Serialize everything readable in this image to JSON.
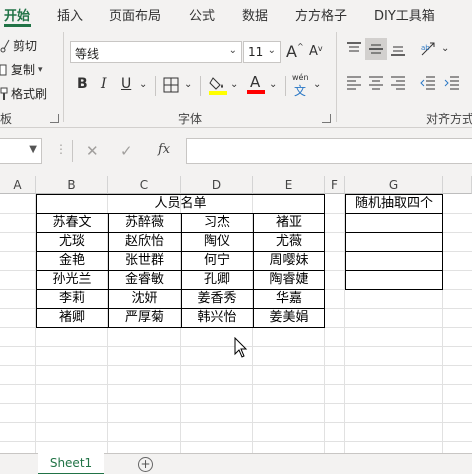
{
  "ribbon_tabs": [
    "开始",
    "插入",
    "页面布局",
    "公式",
    "数据",
    "方方格子",
    "DIY工具箱"
  ],
  "clipboard": {
    "cut": "剪切",
    "copy": "复制",
    "format_painter": "格式刷",
    "group_label": "板"
  },
  "font": {
    "name": "等线",
    "size": "11",
    "grow": "A",
    "shrink": "A",
    "bold": "B",
    "italic": "I",
    "underline": "U",
    "font_color_letter": "A",
    "phonetic_top": "wén",
    "phonetic_bottom": "文",
    "group_label": "字体"
  },
  "alignment": {
    "group_label": "对齐方式"
  },
  "formula_bar": {
    "fx": "fx",
    "cancel": "✕",
    "confirm": "✓",
    "value": ""
  },
  "columns": [
    "A",
    "B",
    "C",
    "D",
    "E",
    "F",
    "G"
  ],
  "table": {
    "title": "人员名单",
    "rows": [
      [
        "苏春文",
        "苏醉薇",
        "习杰",
        "褚亚"
      ],
      [
        "尤琰",
        "赵欣怡",
        "陶仪",
        "尤薇"
      ],
      [
        "金艳",
        "张世群",
        "何宁",
        "周嘤妹"
      ],
      [
        "孙光兰",
        "金睿敏",
        "孔卿",
        "陶睿婕"
      ],
      [
        "李莉",
        "沈妍",
        "姜香秀",
        "华嘉"
      ],
      [
        "褚卿",
        "严厚菊",
        "韩兴怡",
        "姜美娟"
      ]
    ]
  },
  "random_header": "随机抽取四个",
  "sheet_tab": "Sheet1",
  "add_sheet": "+",
  "colors": {
    "accent": "#217346",
    "highlight_yellow": "#ffff00",
    "font_red": "#ff0000"
  }
}
